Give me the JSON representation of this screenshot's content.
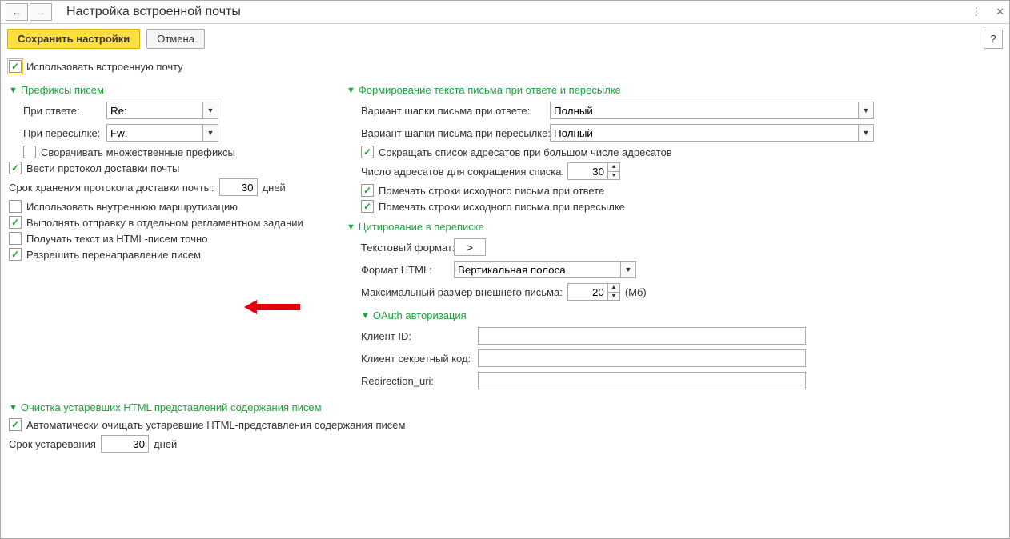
{
  "header": {
    "title": "Настройка встроенной почты"
  },
  "toolbar": {
    "save": "Сохранить настройки",
    "cancel": "Отмена",
    "help": "?"
  },
  "main": {
    "use_internal_mail": "Использовать встроенную почту"
  },
  "prefixes": {
    "heading": "Префиксы писем",
    "reply_label": "При ответе:",
    "reply_value": "Re:",
    "forward_label": "При пересылке:",
    "forward_value": "Fw:",
    "collapse_multiple": "Сворачивать множественные префиксы",
    "delivery_log": "Вести протокол доставки почты",
    "log_retention_label": "Срок хранения протокола доставки почты:",
    "log_retention_value": "30",
    "log_retention_unit": "дней",
    "internal_routing": "Использовать внутреннюю маршрутизацию",
    "send_separate_job": "Выполнять отправку в отдельном регламентном задании",
    "html_exact": "Получать текст из HTML-писем точно",
    "allow_redirect": "Разрешить перенаправление писем"
  },
  "reply_fwd": {
    "heading": "Формирование текста письма при ответе и пересылке",
    "reply_header_label": "Вариант шапки письма при ответе:",
    "reply_header_value": "Полный",
    "fwd_header_label": "Вариант шапки письма при пересылке:",
    "fwd_header_value": "Полный",
    "shorten_recipients": "Сокращать список адресатов при большом числе адресатов",
    "shorten_count_label": "Число адресатов для сокращения списка:",
    "shorten_count_value": "30",
    "mark_lines_reply": "Помечать строки исходного письма при ответе",
    "mark_lines_fwd": "Помечать строки исходного письма при пересылке"
  },
  "quoting": {
    "heading": "Цитирование в переписке",
    "text_fmt_label": "Текстовый формат:",
    "text_fmt_value": ">",
    "html_fmt_label": "Формат HTML:",
    "html_fmt_value": "Вертикальная полоса",
    "max_size_label": "Максимальный размер внешнего письма:",
    "max_size_value": "20",
    "max_size_unit": "(Мб)"
  },
  "oauth": {
    "heading": "OAuth авторизация",
    "client_id": "Клиент ID:",
    "client_secret": "Клиент секретный код:",
    "redirect_uri": "Redirection_uri:"
  },
  "cleanup": {
    "heading": "Очистка устаревших HTML представлений содержания писем",
    "auto_clean": "Автоматически очищать устаревшие HTML-представления содержания писем",
    "age_label": "Срок устаревания",
    "age_value": "30",
    "age_unit": "дней"
  }
}
